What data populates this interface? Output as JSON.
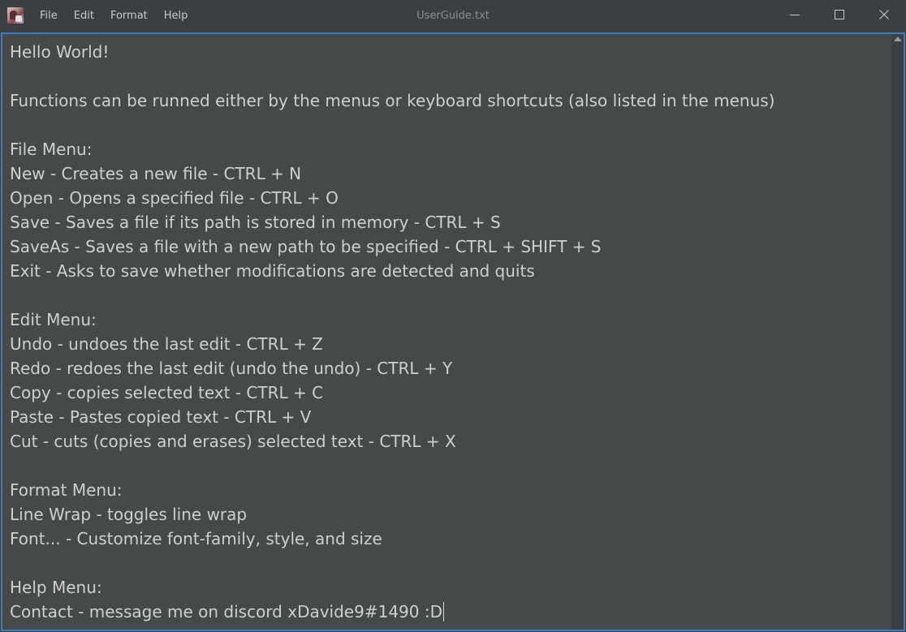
{
  "window": {
    "title": "UserGuide.txt"
  },
  "menubar": {
    "items": [
      {
        "label": "File"
      },
      {
        "label": "Edit"
      },
      {
        "label": "Format"
      },
      {
        "label": "Help"
      }
    ]
  },
  "controls": {
    "minimize_icon": "minimize-icon",
    "maximize_icon": "maximize-icon",
    "close_icon": "close-icon"
  },
  "editor": {
    "lines": [
      "Hello World!",
      "",
      "Functions can be runned either by the menus or keyboard shortcuts (also listed in the menus)",
      "",
      "File Menu:",
      "New - Creates a new file - CTRL + N",
      "Open - Opens a specified file - CTRL + O",
      "Save - Saves a file if its path is stored in memory - CTRL + S",
      "SaveAs - Saves a file with a new path to be specified - CTRL + SHIFT + S",
      "Exit - Asks to save whether modifications are detected and quits",
      "",
      "Edit Menu:",
      "Undo - undoes the last edit - CTRL + Z",
      "Redo - redoes the last edit (undo the undo) - CTRL + Y",
      "Copy - copies selected text - CTRL + C",
      "Paste - Pastes copied text - CTRL + V",
      "Cut - cuts (copies and erases) selected text - CTRL + X",
      "",
      "Format Menu:",
      "Line Wrap - toggles line wrap",
      "Font... - Customize font-family, style, and size",
      "",
      "Help Menu:",
      "Contact - message me on discord xDavide9#1490 :D"
    ]
  },
  "colors": {
    "background": "#3c3f41",
    "editor_background": "#45494a",
    "editor_border": "#4a78b0",
    "text": "#cfcfcf"
  }
}
